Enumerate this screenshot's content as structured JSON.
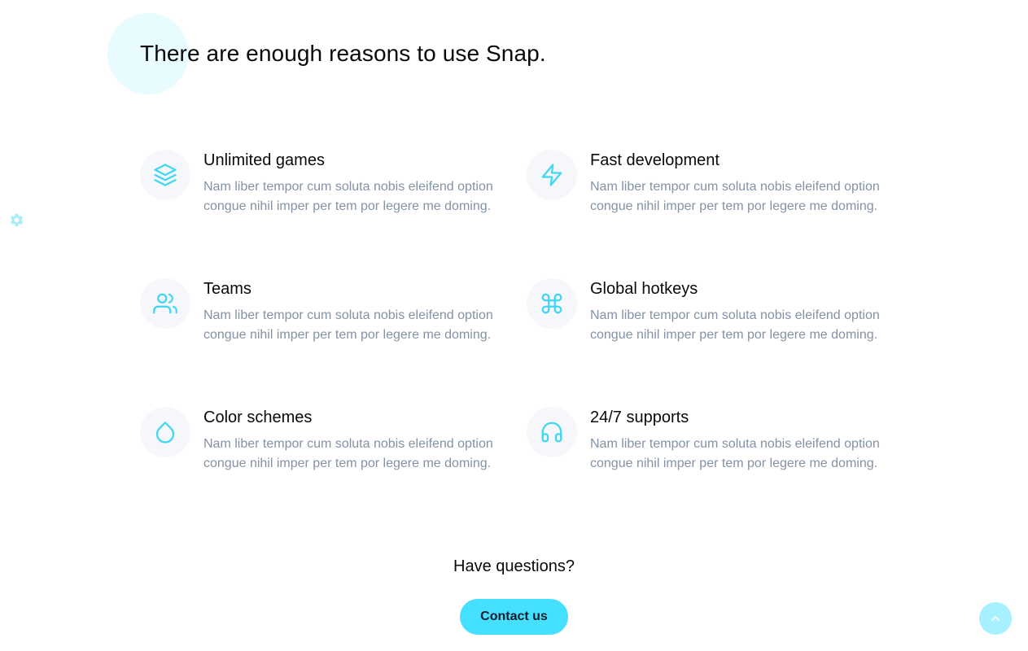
{
  "heading": "There are enough reasons to use Snap.",
  "features": [
    {
      "title": "Unlimited games",
      "icon": "layers-icon",
      "description": "Nam liber tempor cum soluta nobis eleifend option congue nihil imper per tem por legere me doming."
    },
    {
      "title": "Fast development",
      "icon": "zap-icon",
      "description": "Nam liber tempor cum soluta nobis eleifend option congue nihil imper per tem por legere me doming."
    },
    {
      "title": "Teams",
      "icon": "users-icon",
      "description": "Nam liber tempor cum soluta nobis eleifend option congue nihil imper per tem por legere me doming."
    },
    {
      "title": "Global hotkeys",
      "icon": "command-icon",
      "description": "Nam liber tempor cum soluta nobis eleifend option congue nihil imper per tem por legere me doming."
    },
    {
      "title": "Color schemes",
      "icon": "droplet-icon",
      "description": "Nam liber tempor cum soluta nobis eleifend option congue nihil imper per tem por legere me doming."
    },
    {
      "title": "24/7 supports",
      "icon": "headphones-icon",
      "description": "Nam liber tempor cum soluta nobis eleifend option congue nihil imper per tem por legere me doming."
    }
  ],
  "cta": {
    "question": "Have questions?",
    "button_label": "Contact us"
  },
  "colors": {
    "accent": "#45e0ff",
    "icon_stroke": "#3fd6f3",
    "text_muted": "#8492a6",
    "icon_bg": "#f5f7fa"
  },
  "widgets": {
    "settings_icon": "gear-icon",
    "back_to_top_icon": "chevron-up-icon"
  }
}
